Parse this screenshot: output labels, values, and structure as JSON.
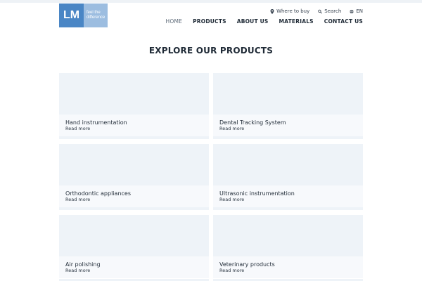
{
  "brand": {
    "logo_text": "LM",
    "tagline_line1": "feel the",
    "tagline_line2": "difference",
    "logo_color": "#4a86c5",
    "logo_tag_color": "#9cbde0"
  },
  "utility": {
    "where_to_buy": "Where to buy",
    "where_icon": "map-pin-icon",
    "search": "Search",
    "search_icon": "search-icon",
    "language": "EN",
    "language_icon": "globe-icon"
  },
  "nav": {
    "items": [
      {
        "label": "HOME"
      },
      {
        "label": "PRODUCTS"
      },
      {
        "label": "ABOUT US"
      },
      {
        "label": "MATERIALS"
      },
      {
        "label": "CONTACT US"
      }
    ]
  },
  "main": {
    "title": "EXPLORE OUR PRODUCTS",
    "read_more": "Read more",
    "products": [
      {
        "title": "Hand instrumentation"
      },
      {
        "title": "Dental Tracking System"
      },
      {
        "title": "Orthodontic appliances"
      },
      {
        "title": "Ultrasonic instrumentation"
      },
      {
        "title": "Air polishing"
      },
      {
        "title": "Veterinary products"
      }
    ]
  }
}
